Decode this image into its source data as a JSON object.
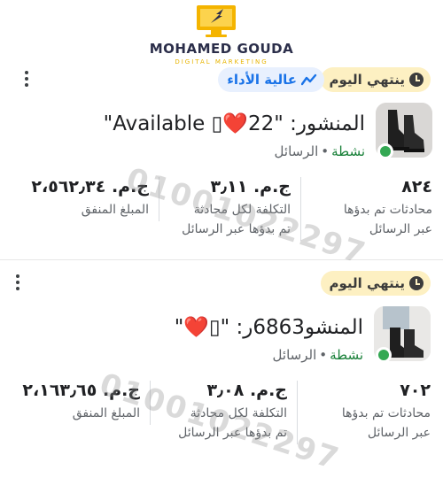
{
  "brand": {
    "name": "MOHAMED GOUDA",
    "tagline": "DIGITAL MARKETING"
  },
  "cards": [
    {
      "deadline_chip": "ينتهي اليوم",
      "performance_chip": "عالية الأداء",
      "post_title": "المنشور: \"22❤️▯ Available\"",
      "status_active": "نشطة",
      "status_separator": "•",
      "status_type": "الرسائل",
      "metrics": {
        "conversations": {
          "value": "٨٢٤",
          "label_line1": "محادثات تم بدؤها",
          "label_line2": "عبر الرسائل"
        },
        "cost_per": {
          "value": "ج.م. ٣٫١١",
          "label_line1": "التكلفة لكل محادثة",
          "label_line2": "تم بدؤها عبر الرسائل"
        },
        "spent": {
          "value": "ج.م. ٢،٥٦٢٫٣٤",
          "label_line1": "المبلغ المنفق"
        }
      }
    },
    {
      "deadline_chip": "ينتهي اليوم",
      "post_title": "المنشو6863ر: \"▯❤️\"",
      "status_active": "نشطة",
      "status_separator": "•",
      "status_type": "الرسائل",
      "metrics": {
        "conversations": {
          "value": "٧٠٢",
          "label_line1": "محادثات تم بدؤها",
          "label_line2": "عبر الرسائل"
        },
        "cost_per": {
          "value": "ج.م. ٣٫٠٨",
          "label_line1": "التكلفة لكل محادثة",
          "label_line2": "تم بدؤها عبر الرسائل"
        },
        "spent": {
          "value": "ج.م. ٢،١٦٣٫٦٥",
          "label_line1": "المبلغ المنفق"
        }
      }
    }
  ],
  "watermark": "01001022297",
  "colors": {
    "active_green": "#34a853",
    "deadline_chip_bg": "#fdf0c2",
    "performance_chip_bg": "#e8f0fe",
    "performance_blue": "#1a73e8"
  }
}
